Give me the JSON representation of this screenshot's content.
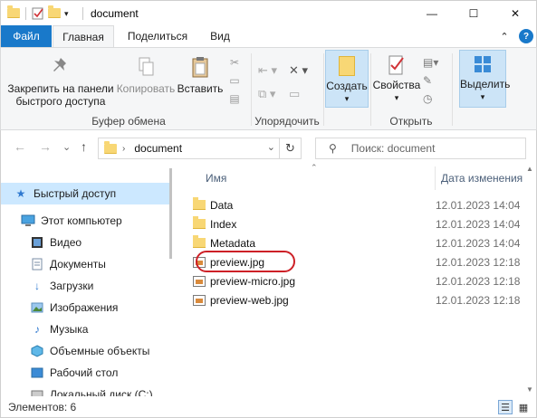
{
  "window": {
    "title": "document",
    "minimize": "—",
    "maximize": "☐",
    "close": "✕"
  },
  "tabs": {
    "file": "Файл",
    "home": "Главная",
    "share": "Поделиться",
    "view": "Вид"
  },
  "ribbon": {
    "pin": "Закрепить на панели быстрого доступа",
    "pin_l1": "Закрепить на панели",
    "pin_l2": "быстрого доступа",
    "copy": "Копировать",
    "paste": "Вставить",
    "group_clipboard": "Буфер обмена",
    "group_organize": "Упорядочить",
    "create": "Создать",
    "properties": "Свойства",
    "group_open": "Открыть",
    "select": "Выделить"
  },
  "nav": {
    "back": "←",
    "forward": "→",
    "recent": "⌄",
    "up": "↑",
    "address": "document",
    "search_placeholder": "Поиск: document"
  },
  "sidebar": {
    "items": [
      {
        "label": "Быстрый доступ",
        "icon": "star-icon"
      },
      {
        "label": "Этот компьютер",
        "icon": "computer-icon"
      },
      {
        "label": "Видео",
        "icon": "video-icon"
      },
      {
        "label": "Документы",
        "icon": "documents-icon"
      },
      {
        "label": "Загрузки",
        "icon": "downloads-icon"
      },
      {
        "label": "Изображения",
        "icon": "pictures-icon"
      },
      {
        "label": "Музыка",
        "icon": "music-icon"
      },
      {
        "label": "Объемные объекты",
        "icon": "3d-objects-icon"
      },
      {
        "label": "Рабочий стол",
        "icon": "desktop-icon"
      },
      {
        "label": "Локальный диск (C:)",
        "icon": "drive-icon"
      }
    ]
  },
  "list": {
    "col_name": "Имя",
    "col_date": "Дата изменения",
    "rows": [
      {
        "name": "Data",
        "date": "12.01.2023 14:04",
        "type": "folder"
      },
      {
        "name": "Index",
        "date": "12.01.2023 14:04",
        "type": "folder"
      },
      {
        "name": "Metadata",
        "date": "12.01.2023 14:04",
        "type": "folder"
      },
      {
        "name": "preview.jpg",
        "date": "12.01.2023 12:18",
        "type": "image"
      },
      {
        "name": "preview-micro.jpg",
        "date": "12.01.2023 12:18",
        "type": "image"
      },
      {
        "name": "preview-web.jpg",
        "date": "12.01.2023 12:18",
        "type": "image"
      }
    ]
  },
  "status": {
    "count": "Элементов: 6"
  },
  "colors": {
    "file_tab": "#1979ca",
    "selection": "#cce8ff",
    "highlight_ring": "#cd2027",
    "folder": "#f8d775"
  }
}
